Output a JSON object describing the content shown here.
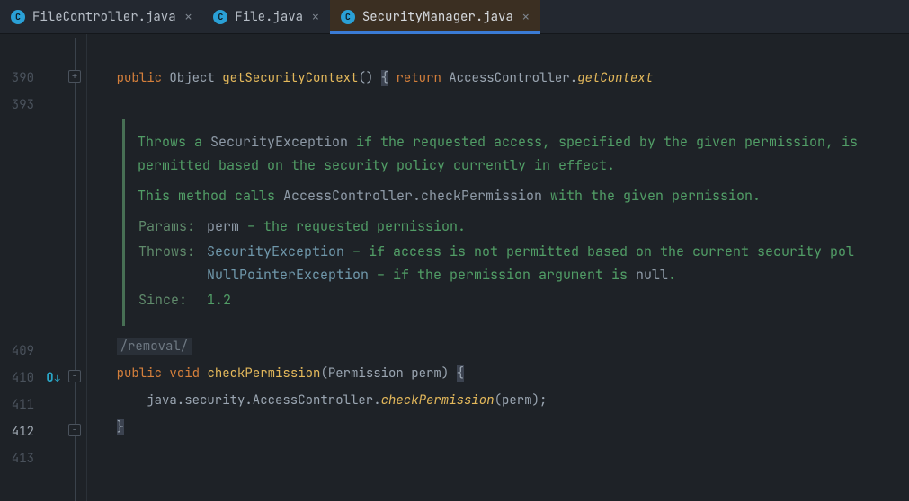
{
  "tabs": [
    {
      "label": "FileController.java",
      "active": false
    },
    {
      "label": "File.java",
      "active": false
    },
    {
      "label": "SecurityManager.java",
      "active": true
    }
  ],
  "lineNumbers": {
    "pre": [
      "390",
      "393"
    ],
    "post": [
      "409",
      "410",
      "411",
      "412",
      "413"
    ]
  },
  "line390": {
    "kw_public": "public",
    "type_object": "Object",
    "m_get": "getSecurityContext",
    "parens": "()",
    "kw_return": "return",
    "type_ac": "AccessController",
    "m_ctx": "getContext"
  },
  "javadoc": {
    "p1_a": "Throws a ",
    "p1_code": "SecurityException",
    "p1_b": " if the requested access, specified by the given permission, is",
    "p1_c": "permitted based on the security policy currently in effect.",
    "p2_a": "This method calls ",
    "p2_code": "AccessController.checkPermission",
    "p2_b": " with the given permission.",
    "params_lbl": "Params:",
    "params_val_code": "perm",
    "params_val_rest": " – the requested permission.",
    "throws_lbl": "Throws:",
    "throws1_link": "SecurityException",
    "throws1_rest": " – if access is not permitted based on the current security pol",
    "throws2_link": "NullPointerException",
    "throws2_rest": " – if the permission argument is ",
    "throws2_code": "null",
    "throws2_dot": ".",
    "since_lbl": "Since:",
    "since_val": "1.2"
  },
  "line409": {
    "comment": "/removal/"
  },
  "line410": {
    "kw_public": "public",
    "kw_void": "void",
    "m_check": "checkPermission",
    "sig_rest": "(Permission perm) "
  },
  "line411": {
    "pkg": "java.security.AccessController.",
    "m_call": "checkPermission",
    "args": "(perm);"
  }
}
